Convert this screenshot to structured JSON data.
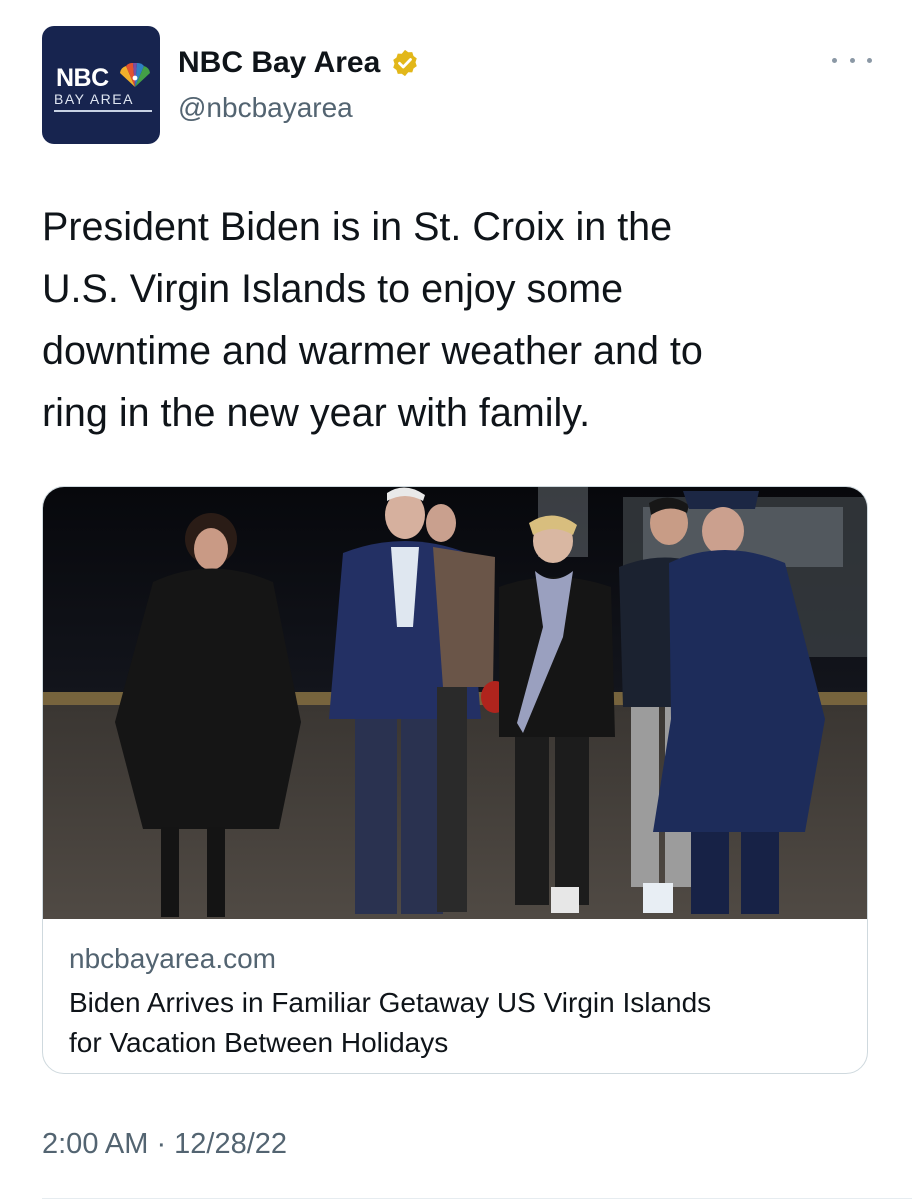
{
  "account": {
    "display_name": "NBC Bay Area",
    "handle": "@nbcbayarea",
    "avatar_logo_text": "NBC",
    "avatar_logo_subtext": "BAY AREA",
    "verified_icon": "verified-badge-gold",
    "verified_color": "#e2b719",
    "more_icon": "more-horizontal-icon"
  },
  "tweet": {
    "lines": [
      "President Biden is in St. Croix in the",
      "U.S. Virgin Islands to enjoy some",
      "downtime and warmer weather and to",
      "ring in the new year with family."
    ],
    "timestamp": "2:00 AM · 12/28/22"
  },
  "card": {
    "image_icon": "news-photo",
    "domain": "nbcbayarea.com",
    "title_lines": [
      "Biden Arrives in Familiar Getaway US Virgin Islands",
      "for Vacation Between Holidays"
    ]
  },
  "colors": {
    "brand_navy": "#17244f",
    "text_primary": "#0f1419",
    "text_secondary": "#536471",
    "border": "#cfd9de"
  }
}
